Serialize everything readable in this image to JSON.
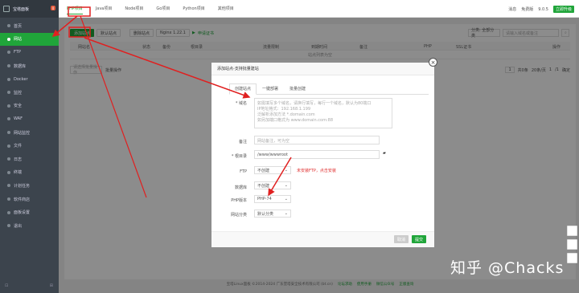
{
  "app": {
    "title": "宝塔面板",
    "badge": "0"
  },
  "sidebar": {
    "items": [
      {
        "label": "首页"
      },
      {
        "label": "网站"
      },
      {
        "label": "FTP"
      },
      {
        "label": "数据库"
      },
      {
        "label": "Docker"
      },
      {
        "label": "监控"
      },
      {
        "label": "安全"
      },
      {
        "label": "WAF"
      },
      {
        "label": "网站监控"
      },
      {
        "label": "文件"
      },
      {
        "label": "日志"
      },
      {
        "label": "终端"
      },
      {
        "label": "计划任务"
      },
      {
        "label": "软件商店"
      },
      {
        "label": "面板设置"
      },
      {
        "label": "退出"
      }
    ],
    "active_index": 1,
    "bottom_left": "⊡",
    "bottom_right": "⊞"
  },
  "top": {
    "tabs": [
      {
        "label": "PHP项目"
      },
      {
        "label": "Java项目"
      },
      {
        "label": "Node项目"
      },
      {
        "label": "Go项目"
      },
      {
        "label": "Python项目"
      },
      {
        "label": "其他项目"
      }
    ],
    "active_tab": 0,
    "user": "消息",
    "edition": "免费版",
    "version": "9.0.5",
    "update_label": "立即升级"
  },
  "toolbar": {
    "add_site": "添加站点",
    "default_site": "默认站点",
    "recycle": "删除站点",
    "nginx": "Nginx 1.22.1",
    "nginx_action": "▶",
    "safe": "申请证书"
  },
  "filter": {
    "category": "分类: 全部分类",
    "search_placeholder": "请输入域名或备注"
  },
  "table": {
    "headers": [
      "网站名",
      "状态",
      "备份",
      "根目录",
      "流量限制",
      "到期时间",
      "备注",
      "PHP",
      "SSL证书",
      "操作"
    ],
    "empty_text": "站点列表为空",
    "batch_placeholder": "请选择批量操作",
    "batch_button": "批量操作",
    "pagination": [
      "1",
      "共0条",
      "20条/页",
      "1",
      "/1",
      "确定"
    ]
  },
  "copyright": {
    "text": "宝塔Linux面板 ©2014-2024 广东堡塔安全技术有限公司 (bt.cn)",
    "links": [
      "论坛求助",
      "使用手册",
      "微信公众号",
      "正版查询"
    ]
  },
  "modal": {
    "title": "添加站点-支持批量建站",
    "close": "×",
    "tabs": [
      {
        "label": "创建站点"
      },
      {
        "label": "一键部署"
      },
      {
        "label": "批量创建"
      }
    ],
    "active_tab": 0,
    "domain_label": "* 域名",
    "domain_placeholder_lines": [
      "如需填写多个域名，请换行填写，每行一个域名，默认为80端口",
      "IP地址格式：192.168.1.199",
      "泛解析添加方法 *.domain.com",
      "如另加端口格式为 www.domain.com:88"
    ],
    "note_label": "备注",
    "note_placeholder": "网站备注，可为空",
    "root_label": "* 根目录",
    "root_value": "/www/wwwroot",
    "ftp_label": "FTP",
    "ftp_value": "不创建",
    "ftp_hint": "未安装FTP，点击安装",
    "db_label": "数据库",
    "db_value": "不创建",
    "php_label": "PHP版本",
    "php_value": "PHP-74",
    "category_label": "网站分类",
    "category_value": "默认分类",
    "cancel": "取消",
    "submit": "提交"
  },
  "watermark": "知乎 @Chacks",
  "colors": {
    "accent": "#20a53a",
    "sidebar": "#3c444d",
    "arrow": "#e02020"
  }
}
